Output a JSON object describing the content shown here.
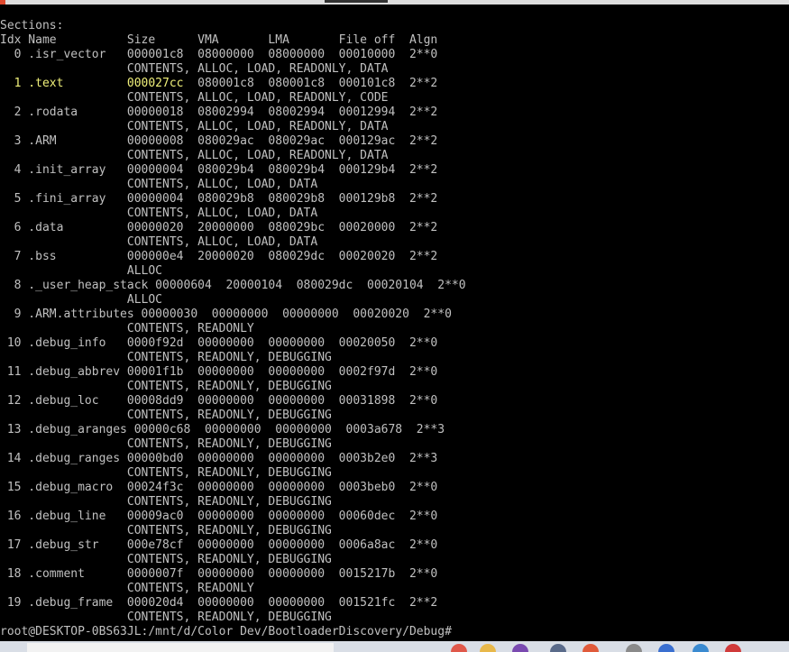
{
  "terminal": {
    "lines": [
      {
        "text": "Sections:"
      },
      {
        "text": "Idx Name          Size      VMA       LMA       File off  Algn"
      },
      {
        "text": "  0 .isr_vector   000001c8  08000000  08000000  00010000  2**0"
      },
      {
        "text": "                  CONTENTS, ALLOC, LOAD, READONLY, DATA"
      },
      {
        "text": "  1 .text         000027cc  080001c8  080001c8  000101c8  2**2",
        "highlight": true,
        "hl_prefix": "  1 .text         000027cc",
        "hl_rest": "  080001c8  080001c8  000101c8  2**2"
      },
      {
        "text": "                  CONTENTS, ALLOC, LOAD, READONLY, CODE"
      },
      {
        "text": "  2 .rodata       00000018  08002994  08002994  00012994  2**2"
      },
      {
        "text": "                  CONTENTS, ALLOC, LOAD, READONLY, DATA"
      },
      {
        "text": "  3 .ARM          00000008  080029ac  080029ac  000129ac  2**2"
      },
      {
        "text": "                  CONTENTS, ALLOC, LOAD, READONLY, DATA"
      },
      {
        "text": "  4 .init_array   00000004  080029b4  080029b4  000129b4  2**2"
      },
      {
        "text": "                  CONTENTS, ALLOC, LOAD, DATA"
      },
      {
        "text": "  5 .fini_array   00000004  080029b8  080029b8  000129b8  2**2"
      },
      {
        "text": "                  CONTENTS, ALLOC, LOAD, DATA"
      },
      {
        "text": "  6 .data         00000020  20000000  080029bc  00020000  2**2"
      },
      {
        "text": "                  CONTENTS, ALLOC, LOAD, DATA"
      },
      {
        "text": "  7 .bss          000000e4  20000020  080029dc  00020020  2**2"
      },
      {
        "text": "                  ALLOC"
      },
      {
        "text": "  8 ._user_heap_stack 00000604  20000104  080029dc  00020104  2**0"
      },
      {
        "text": "                  ALLOC"
      },
      {
        "text": "  9 .ARM.attributes 00000030  00000000  00000000  00020020  2**0"
      },
      {
        "text": "                  CONTENTS, READONLY"
      },
      {
        "text": " 10 .debug_info   0000f92d  00000000  00000000  00020050  2**0"
      },
      {
        "text": "                  CONTENTS, READONLY, DEBUGGING"
      },
      {
        "text": " 11 .debug_abbrev 00001f1b  00000000  00000000  0002f97d  2**0"
      },
      {
        "text": "                  CONTENTS, READONLY, DEBUGGING"
      },
      {
        "text": " 12 .debug_loc    00008dd9  00000000  00000000  00031898  2**0"
      },
      {
        "text": "                  CONTENTS, READONLY, DEBUGGING"
      },
      {
        "text": " 13 .debug_aranges 00000c68  00000000  00000000  0003a678  2**3"
      },
      {
        "text": "                  CONTENTS, READONLY, DEBUGGING"
      },
      {
        "text": " 14 .debug_ranges 00000bd0  00000000  00000000  0003b2e0  2**3"
      },
      {
        "text": "                  CONTENTS, READONLY, DEBUGGING"
      },
      {
        "text": " 15 .debug_macro  00024f3c  00000000  00000000  0003beb0  2**0"
      },
      {
        "text": "                  CONTENTS, READONLY, DEBUGGING"
      },
      {
        "text": " 16 .debug_line   00009ac0  00000000  00000000  00060dec  2**0"
      },
      {
        "text": "                  CONTENTS, READONLY, DEBUGGING"
      },
      {
        "text": " 17 .debug_str    000e78cf  00000000  00000000  0006a8ac  2**0"
      },
      {
        "text": "                  CONTENTS, READONLY, DEBUGGING"
      },
      {
        "text": " 18 .comment      0000007f  00000000  00000000  0015217b  2**0"
      },
      {
        "text": "                  CONTENTS, READONLY"
      },
      {
        "text": " 19 .debug_frame  000020d4  00000000  00000000  001521fc  2**2"
      },
      {
        "text": "                  CONTENTS, READONLY, DEBUGGING"
      }
    ],
    "prompt": "root@DESKTOP-0BS63JL:/mnt/d/Color Dev/BootloaderDiscovery/Debug#"
  },
  "colors": {
    "background": "#000000",
    "text": "#c0c0c0",
    "highlight_text": "#f0f07a"
  },
  "taskbar": {
    "icons": [
      "browser-icon",
      "folder-icon",
      "media-icon",
      "document-icon",
      "app-icon",
      "files-icon",
      "mail-icon",
      "chrome-icon",
      "pdf-icon"
    ]
  }
}
